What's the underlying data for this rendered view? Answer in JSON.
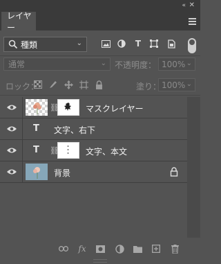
{
  "window": {
    "collapse_label": "«",
    "close_label": "✕"
  },
  "tab": {
    "label": "レイヤー"
  },
  "filter": {
    "label": "種類"
  },
  "blend": {
    "mode": "通常"
  },
  "opacity": {
    "label": "不透明度：",
    "value": "100%"
  },
  "lock": {
    "label": "ロック："
  },
  "fill": {
    "label": "塗り：",
    "value": "100%"
  },
  "layers": [
    {
      "name": "マスクレイヤー",
      "type": "image-with-mask"
    },
    {
      "name": "文字、右下",
      "type": "text"
    },
    {
      "name": "文字、本文",
      "type": "text-with-mask"
    },
    {
      "name": "背景",
      "type": "background",
      "locked": true
    }
  ],
  "colors": {
    "panel": "#535353",
    "tab_bar": "#3a3a3a",
    "text": "#f2f2f2",
    "muted": "#8d8d8d",
    "background_thumb": "#86a7b9"
  },
  "icons": {
    "filter_kinds": [
      "image-filter-icon",
      "adjustment-filter-icon",
      "type-filter-icon",
      "shape-filter-icon",
      "smart-object-filter-icon"
    ],
    "lock_options": [
      "lock-transparent-pixels-icon",
      "lock-image-pixels-icon",
      "lock-position-icon",
      "lock-artboard-icon",
      "lock-all-icon"
    ],
    "bottom": [
      "link-layers-icon",
      "fx-icon",
      "add-mask-icon",
      "adjustment-layer-icon",
      "group-folder-icon",
      "new-layer-icon",
      "trash-icon"
    ]
  }
}
